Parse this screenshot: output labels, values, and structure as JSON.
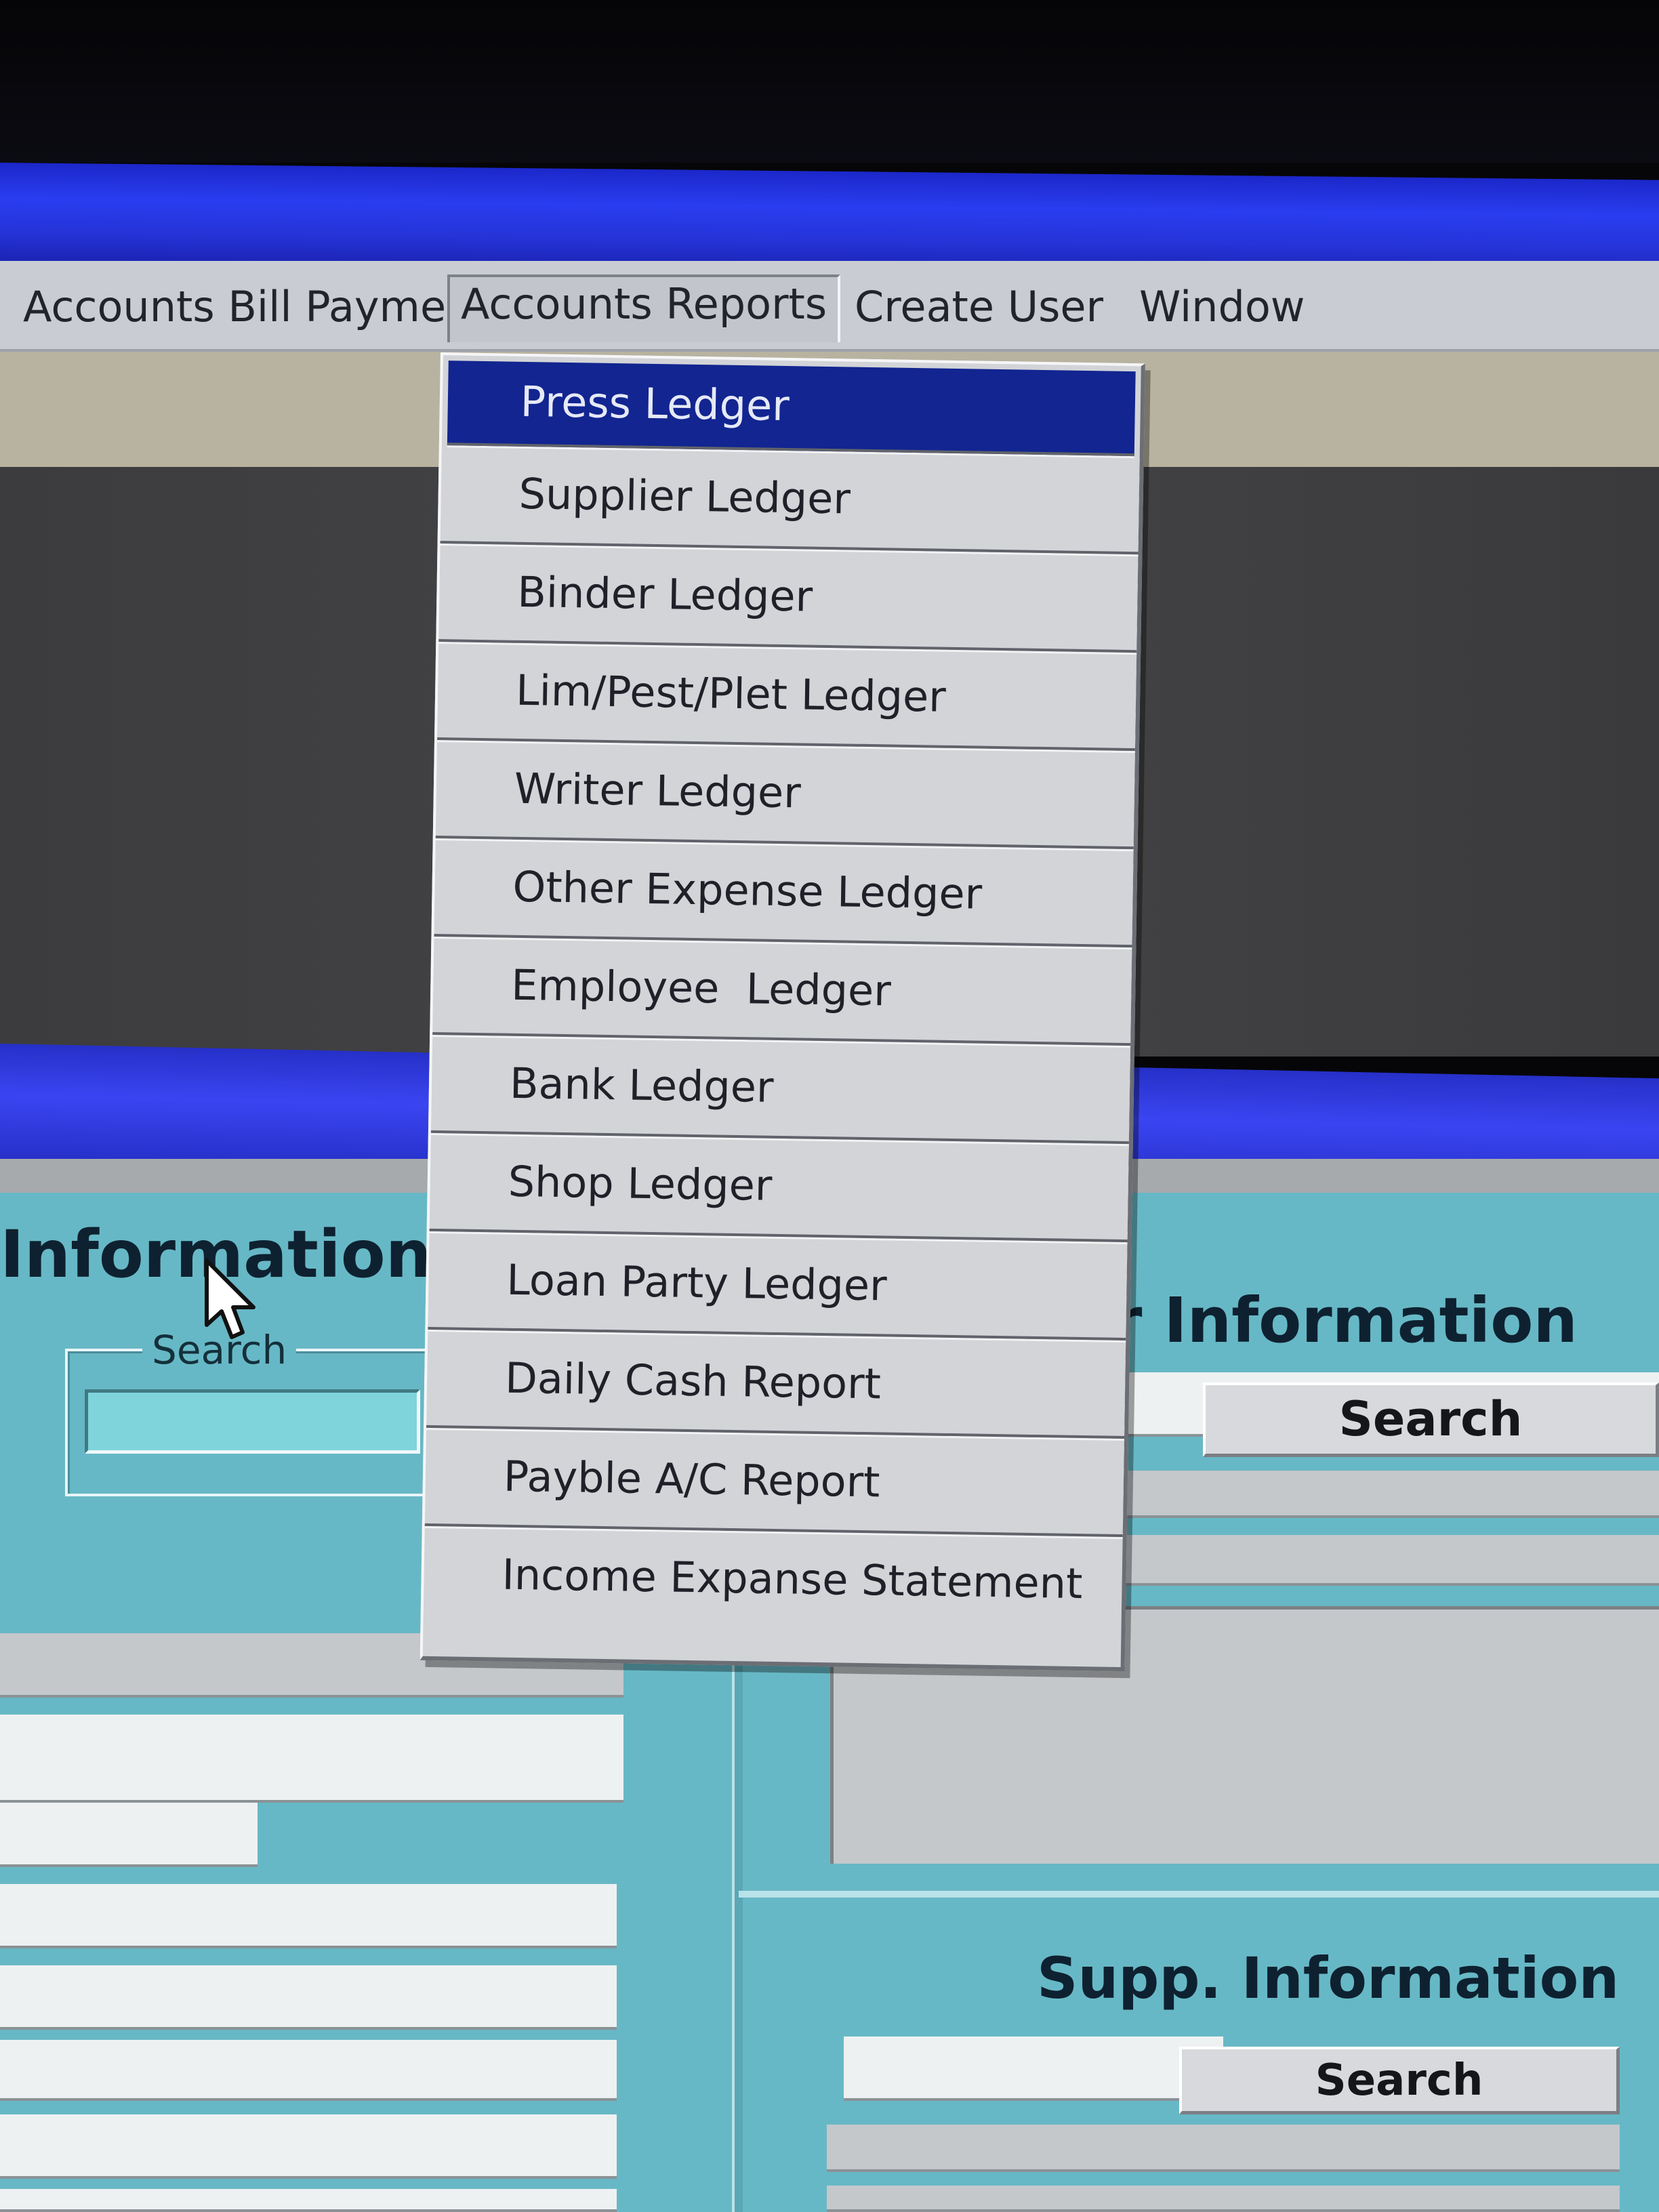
{
  "menubar": {
    "items": [
      {
        "label": "Accounts Bill Payment"
      },
      {
        "label": "Accounts Reports"
      },
      {
        "label": "Create User"
      },
      {
        "label": "Window"
      }
    ]
  },
  "dropdown": {
    "items": [
      {
        "label": "Press Ledger",
        "selected": true
      },
      {
        "label": "Supplier Ledger"
      },
      {
        "label": "Binder Ledger"
      },
      {
        "label": "Lim/Pest/Plet Ledger"
      },
      {
        "label": "Writer Ledger"
      },
      {
        "label": "Other Expense Ledger"
      },
      {
        "label": "Employee  Ledger"
      },
      {
        "label": "Bank Ledger"
      },
      {
        "label": "Shop Ledger"
      },
      {
        "label": "Loan Party Ledger"
      },
      {
        "label": "Daily Cash Report"
      },
      {
        "label": "Payble A/C Report"
      },
      {
        "label": "Income Expanse Statement"
      }
    ]
  },
  "form": {
    "left_heading": "Information For",
    "search_group_label": "Search",
    "right_heading": "r Information",
    "right_search_button": "Search",
    "supp_heading": "Supp. Information",
    "supp_search_button": "Search"
  },
  "colors": {
    "title_bar": "#2a3df0",
    "menu_bar": "#c9ccd2",
    "menu_highlight": "#122590",
    "form_background": "#67b8c6"
  },
  "icons": {
    "cursor": "mouse-pointer-icon"
  }
}
